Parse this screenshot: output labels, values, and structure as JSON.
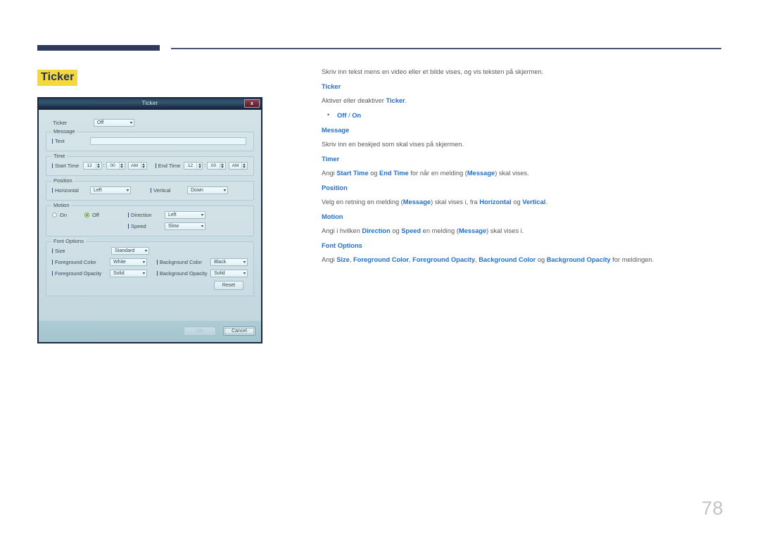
{
  "page": {
    "heading": "Ticker",
    "number": "78"
  },
  "dialog": {
    "title": "Ticker",
    "close_label": "x",
    "ticker": {
      "label": "Ticker",
      "value": "Off"
    },
    "message": {
      "legend": "Message",
      "text_label": "Text",
      "text_value": ""
    },
    "time": {
      "legend": "Time",
      "start_label": "Start Time",
      "start_hour": "12",
      "start_minute": "00",
      "start_meridiem": "AM",
      "end_label": "End Time",
      "end_hour": "12",
      "end_minute": "00",
      "end_meridiem": "AM",
      "colon": ":"
    },
    "position": {
      "legend": "Position",
      "horizontal_label": "Horizontal",
      "horizontal_value": "Left",
      "vertical_label": "Vertical",
      "vertical_value": "Down"
    },
    "motion": {
      "legend": "Motion",
      "on_label": "On",
      "off_label": "Off",
      "selected": "Off",
      "direction_label": "Direction",
      "direction_value": "Left",
      "speed_label": "Speed",
      "speed_value": "Slow"
    },
    "font_options": {
      "legend": "Font Options",
      "size_label": "Size",
      "size_value": "Standard",
      "foreground_color_label": "Foreground Color",
      "foreground_color_value": "White",
      "background_color_label": "Background Color",
      "background_color_value": "Black",
      "foreground_opacity_label": "Foreground Opacity",
      "foreground_opacity_value": "Solid",
      "background_opacity_label": "Background Opacity",
      "background_opacity_value": "Solid",
      "reset_label": "Reset"
    },
    "footer": {
      "ok_label": "OK",
      "cancel_label": "Cancel"
    }
  },
  "doc": {
    "intro": "Skriv inn tekst mens en video eller et bilde vises, og vis teksten på skjermen.",
    "ticker_heading": "Ticker",
    "ticker_desc_1": "Aktiver eller deaktiver ",
    "ticker_desc_term": "Ticker",
    "ticker_desc_2": ".",
    "ticker_bullet_off": "Off",
    "ticker_bullet_sep": " / ",
    "ticker_bullet_on": "On",
    "message_heading": "Message",
    "message_desc": "Skriv inn en beskjed som skal vises på skjermen.",
    "timer_heading": "Timer",
    "timer_desc_1": "Angi ",
    "timer_term_1": "Start Time",
    "timer_desc_2": " og ",
    "timer_term_2": "End Time",
    "timer_desc_3": " for når en melding (",
    "timer_term_3": "Message",
    "timer_desc_4": ") skal vises.",
    "position_heading": "Position",
    "position_desc_1": "Velg en retning en melding (",
    "position_term_1": "Message",
    "position_desc_2": ") skal vises i, fra ",
    "position_term_2": "Horizontal",
    "position_desc_3": " og ",
    "position_term_3": "Vertical",
    "position_desc_4": ".",
    "motion_heading": "Motion",
    "motion_desc_1": "Angi i hvilken ",
    "motion_term_1": "Direction",
    "motion_desc_2": " og ",
    "motion_term_2": "Speed",
    "motion_desc_3": " en melding (",
    "motion_term_3": "Message",
    "motion_desc_4": ") skal vises i.",
    "font_heading": "Font Options",
    "font_desc_1": "Angi ",
    "font_term_1": "Size",
    "font_desc_2": ", ",
    "font_term_2": "Foreground Color",
    "font_desc_3": ", ",
    "font_term_3": "Foreground Opacity",
    "font_desc_4": ", ",
    "font_term_4": "Background Color",
    "font_desc_5": " og ",
    "font_term_5": "Background Opacity",
    "font_desc_6": " for meldingen."
  }
}
